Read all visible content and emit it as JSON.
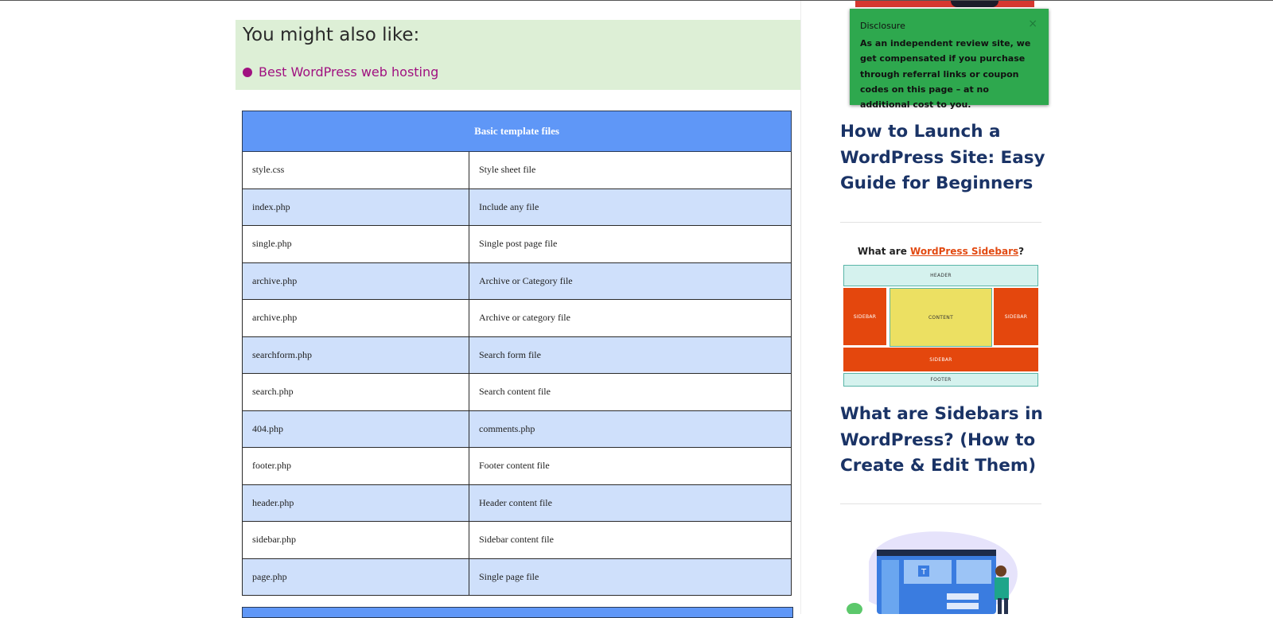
{
  "also_like": {
    "heading": "You might also like:",
    "link": "Best WordPress web hosting",
    "bullet_color": "#a01180"
  },
  "table": {
    "header": "Basic template files",
    "rows": [
      [
        "style.css",
        "Style sheet file"
      ],
      [
        "index.php",
        "Include any file"
      ],
      [
        "single.php",
        "Single post page file"
      ],
      [
        "archive.php",
        "Archive or Category file"
      ],
      [
        "archive.php",
        "Archive or category file"
      ],
      [
        "searchform.php",
        "Search form file"
      ],
      [
        "search.php",
        "Search content file"
      ],
      [
        "404.php",
        "comments.php"
      ],
      [
        "footer.php",
        "Footer content file"
      ],
      [
        "header.php",
        "Header content file"
      ],
      [
        "sidebar.php",
        "Sidebar content file"
      ],
      [
        "page.php",
        "Single page file"
      ]
    ],
    "header_color": "#5f97f7",
    "stripe_color": "#cfe0fb"
  },
  "disclosure": {
    "title": "Disclosure",
    "close": "×",
    "body": "As an independent review site, we get compensated if you purchase through referral links or coupon codes on this page – at no additional cost to you.",
    "bg_color": "#2ea84e"
  },
  "sidebar": {
    "post1_title": "How to Launch a WordPress Site: Easy Guide for Beginners",
    "post2_title": "What are Sidebars in WordPress? (How to Create & Edit Them)",
    "diagram": {
      "title_prefix": "What are ",
      "title_highlight": "WordPress Sidebars",
      "title_suffix": "?",
      "header": "HEADER",
      "sidebar_left": "SIDEBAR",
      "content": "CONTENT",
      "sidebar_right": "SIDEBAR",
      "sidebar_bottom": "SIDEBAR",
      "footer": "FOOTER"
    },
    "title_color": "#1a3366"
  }
}
